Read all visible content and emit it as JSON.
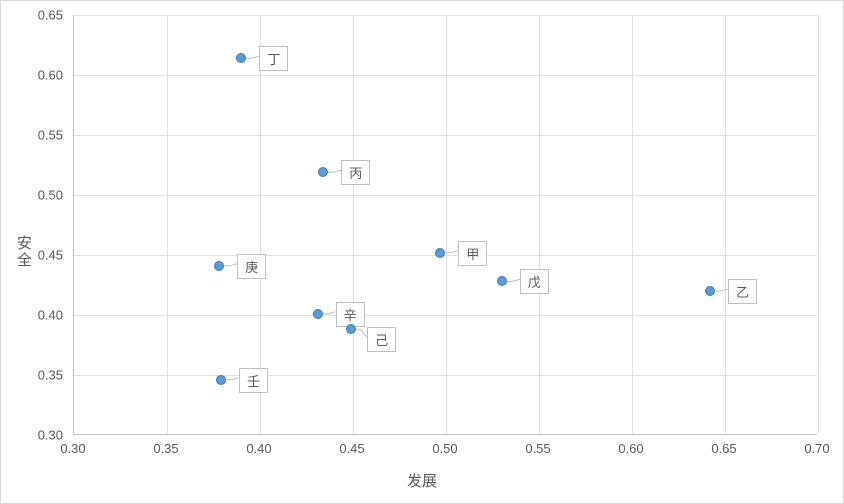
{
  "chart_data": {
    "type": "scatter",
    "xlabel": "发展",
    "ylabel": "安全",
    "xlim": [
      0.3,
      0.7
    ],
    "ylim": [
      0.3,
      0.65
    ],
    "xticks": [
      0.3,
      0.35,
      0.4,
      0.45,
      0.5,
      0.55,
      0.6,
      0.65,
      0.7
    ],
    "yticks": [
      0.3,
      0.35,
      0.4,
      0.45,
      0.5,
      0.55,
      0.6,
      0.65
    ],
    "points": [
      {
        "label": "丁",
        "x": 0.39,
        "y": 0.614,
        "dx": 18,
        "dy": -2
      },
      {
        "label": "丙",
        "x": 0.434,
        "y": 0.519,
        "dx": 18,
        "dy": -2
      },
      {
        "label": "甲",
        "x": 0.497,
        "y": 0.452,
        "dx": 18,
        "dy": -2
      },
      {
        "label": "戊",
        "x": 0.53,
        "y": 0.428,
        "dx": 18,
        "dy": -2
      },
      {
        "label": "乙",
        "x": 0.642,
        "y": 0.42,
        "dx": 18,
        "dy": -2
      },
      {
        "label": "庚",
        "x": 0.378,
        "y": 0.441,
        "dx": 18,
        "dy": -2
      },
      {
        "label": "辛",
        "x": 0.431,
        "y": 0.401,
        "dx": 18,
        "dy": -2
      },
      {
        "label": "己",
        "x": 0.449,
        "y": 0.388,
        "dx": 16,
        "dy": 8
      },
      {
        "label": "壬",
        "x": 0.379,
        "y": 0.346,
        "dx": 18,
        "dy": -2
      }
    ]
  }
}
